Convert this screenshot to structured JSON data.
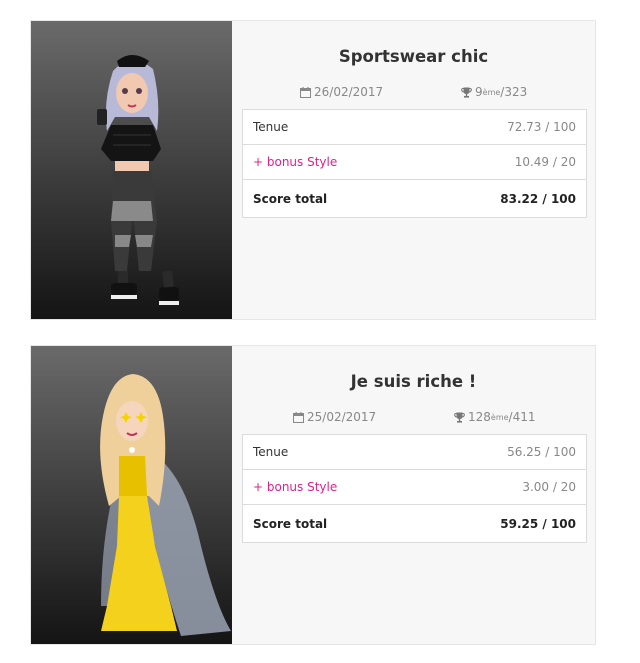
{
  "cards": [
    {
      "title": "Sportswear chic",
      "date": "26/02/2017",
      "rank": "9",
      "rank_suffix": "ème",
      "rank_total": "/323",
      "rows": [
        {
          "label": "Tenue",
          "value": "72.73 / 100"
        },
        {
          "label": "+ bonus Style",
          "value": "10.49 / 20"
        },
        {
          "label": "Score total",
          "value": "83.22 / 100"
        }
      ]
    },
    {
      "title": "Je suis riche !",
      "date": "25/02/2017",
      "rank": "128",
      "rank_suffix": "ème",
      "rank_total": "/411",
      "rows": [
        {
          "label": "Tenue",
          "value": "56.25 / 100"
        },
        {
          "label": "+ bonus Style",
          "value": "3.00 / 20"
        },
        {
          "label": "Score total",
          "value": "59.25 / 100"
        }
      ]
    }
  ],
  "colors": {
    "bonus": "#e0208c",
    "text": "#333333",
    "muted": "#888888"
  },
  "icons": {
    "date": "calendar-icon",
    "rank": "trophy-icon"
  }
}
